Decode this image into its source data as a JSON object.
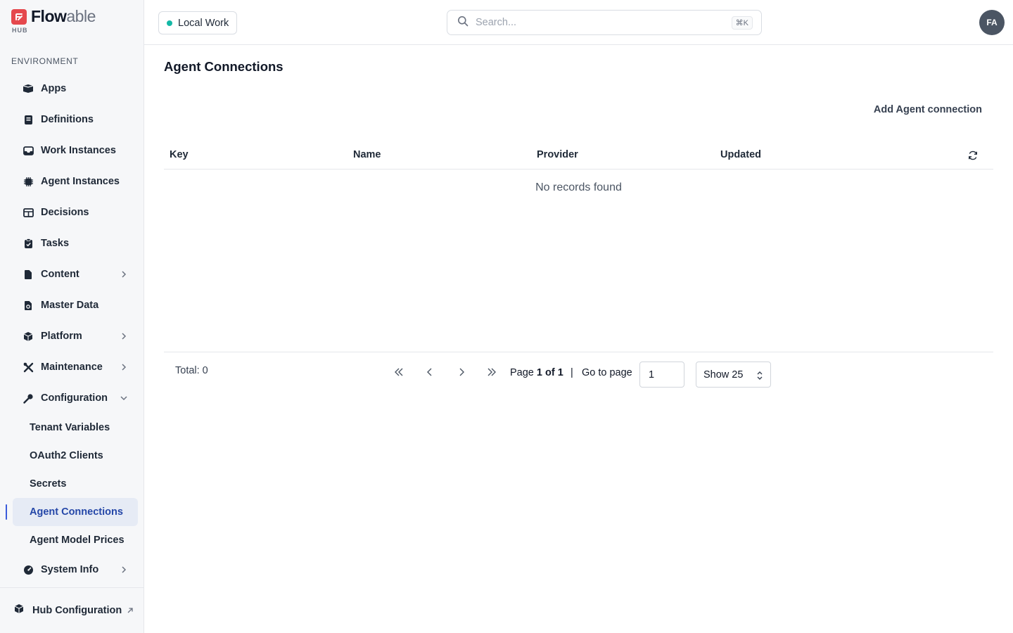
{
  "brand": {
    "name_bold": "Flow",
    "name_light": "able",
    "sub": "HUB"
  },
  "sidebar": {
    "section_label": "ENVIRONMENT",
    "items": [
      {
        "label": "Apps",
        "icon": "box-icon"
      },
      {
        "label": "Definitions",
        "icon": "book-icon"
      },
      {
        "label": "Work Instances",
        "icon": "inbox-icon"
      },
      {
        "label": "Agent Instances",
        "icon": "chip-icon"
      },
      {
        "label": "Decisions",
        "icon": "table-icon"
      },
      {
        "label": "Tasks",
        "icon": "clipboard-check-icon"
      },
      {
        "label": "Content",
        "icon": "file-icon"
      },
      {
        "label": "Master Data",
        "icon": "file-gear-icon"
      },
      {
        "label": "Platform",
        "icon": "cube-icon"
      },
      {
        "label": "Maintenance",
        "icon": "tools-icon"
      },
      {
        "label": "Configuration",
        "icon": "key-icon"
      },
      {
        "label": "System Info",
        "icon": "gauge-icon"
      }
    ],
    "config_sub": [
      "Tenant Variables",
      "OAuth2 Clients",
      "Secrets",
      "Agent Connections",
      "Agent Model Prices"
    ],
    "footer_label": "Hub Configuration"
  },
  "topbar": {
    "env_label": "Local Work",
    "search_placeholder": "Search...",
    "shortcut": "⌘K",
    "avatar_initials": "FA"
  },
  "main": {
    "title": "Agent Connections",
    "add_button": "Add Agent connection",
    "columns": [
      "Key",
      "Name",
      "Provider",
      "Updated"
    ],
    "empty_text": "No records found",
    "total": "Total: 0",
    "page_prefix": "Page ",
    "page_current": "1",
    "page_of": " of ",
    "page_total": "1",
    "separator": "|",
    "goto_label": "Go to page",
    "goto_value": "1",
    "show_label": "Show 25"
  },
  "colors": {
    "accent": "#3b5bdb",
    "active_bg": "#e6ebf5",
    "env_dot": "#14b8a6",
    "logo": "#e5484d"
  }
}
